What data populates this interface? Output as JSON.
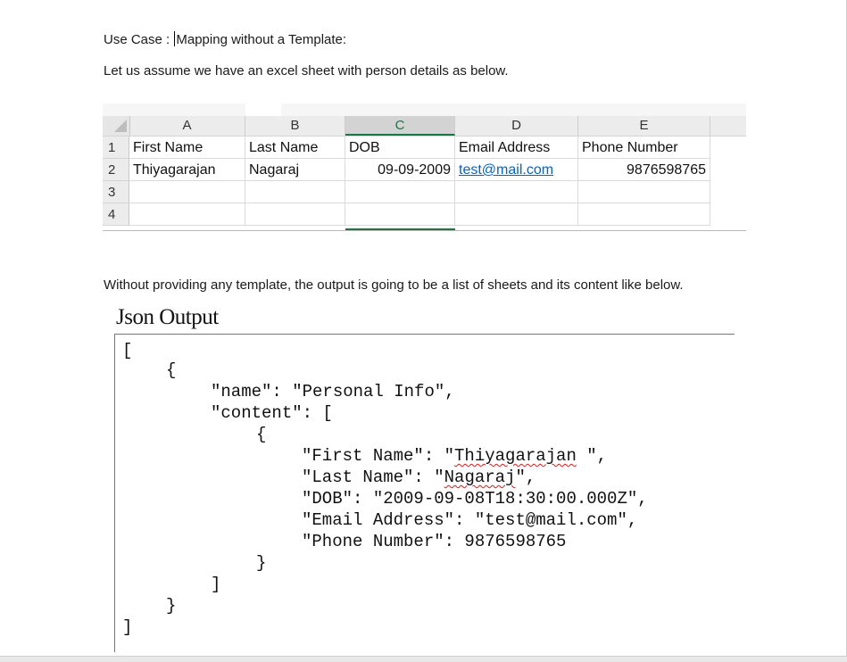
{
  "doc": {
    "use_case_label": "Use Case :",
    "use_case_title": "Mapping without a Template:",
    "intro": "Let us assume we have an excel sheet with person details as below.",
    "description": "Without providing any template, the output is going to be a list of sheets and its content like below."
  },
  "sheet": {
    "columns": [
      "A",
      "B",
      "C",
      "D",
      "E"
    ],
    "selected_column": "C",
    "rows": [
      {
        "num": "1",
        "cells": [
          "First Name",
          "Last Name",
          "DOB",
          "Email Address",
          "Phone Number"
        ]
      },
      {
        "num": "2",
        "cells": [
          "Thiyagarajan",
          "Nagaraj",
          "09-09-2009",
          "test@mail.com",
          "9876598765"
        ]
      },
      {
        "num": "3",
        "cells": [
          "",
          "",
          "",
          "",
          ""
        ]
      },
      {
        "num": "4",
        "cells": [
          "",
          "",
          "",
          "",
          ""
        ]
      }
    ],
    "colors": {
      "header_bg": "#ececec",
      "selection": "#217346",
      "link": "#0563c1"
    }
  },
  "json_output": {
    "title": "Json Output",
    "open_bracket": "[",
    "open_brace": "{",
    "name_line": "\"name\": \"Personal Info\",",
    "content_line": "\"content\": [",
    "inner_open_brace": "{",
    "first_name_key": "\"First Name\": \"",
    "first_name_val": "Thiyagarajan",
    "first_name_end": " \",",
    "last_name_key": "\"Last Name\": \"",
    "last_name_val": "Nagaraj",
    "last_name_end": "\",",
    "dob_line": "\"DOB\": \"2009-09-08T18:30:00.000Z\",",
    "email_line": "\"Email Address\": \"test@mail.com\",",
    "phone_line": "\"Phone Number\": 9876598765",
    "inner_close_brace": "}",
    "close_list": "]",
    "close_brace": "}",
    "close_bracket": "]"
  }
}
